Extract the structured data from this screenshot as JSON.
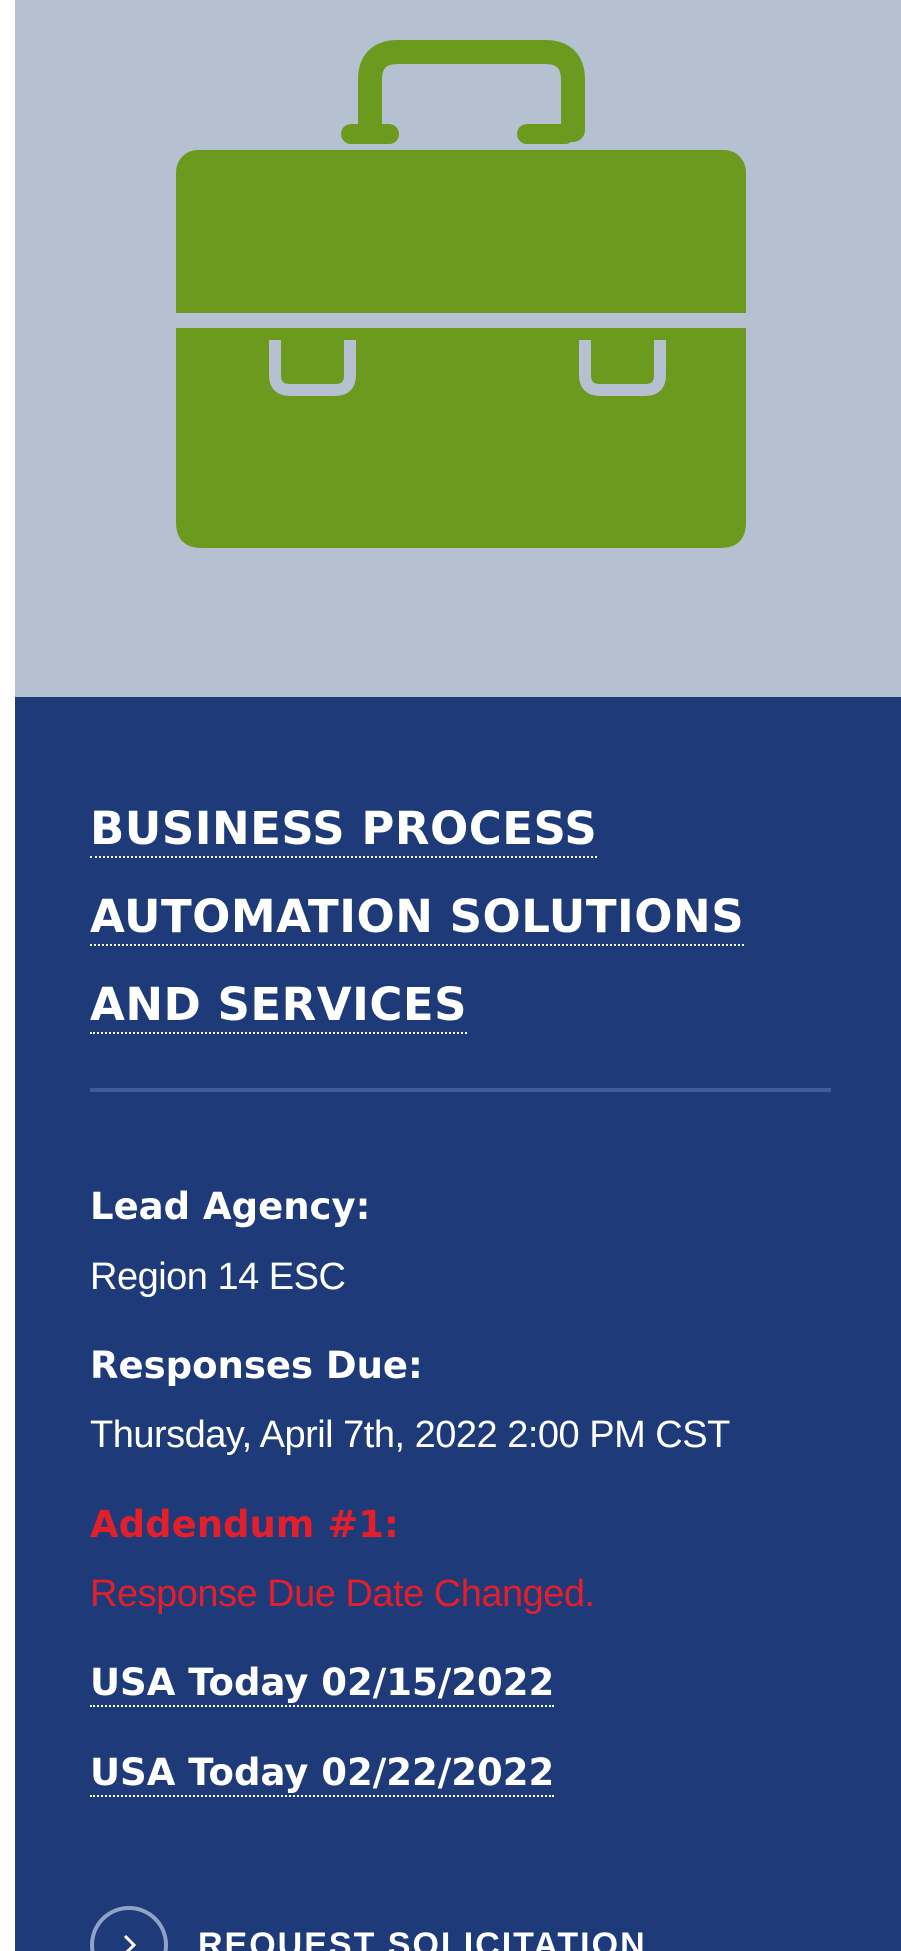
{
  "colors": {
    "hero_background": "#b5c0d0",
    "panel_background": "#1e3a78",
    "icon_green": "#6b9a1f",
    "alert_red": "#e21f2a"
  },
  "hero": {
    "icon": "briefcase-icon"
  },
  "solicitation": {
    "title_line1": "BUSINESS PROCESS",
    "title_line2": "AUTOMATION SOLUTIONS",
    "title_line3": "AND SERVICES",
    "lead_agency_label": "Lead Agency:",
    "lead_agency_value": "Region 14 ESC",
    "responses_due_label": "Responses Due:",
    "responses_due_value": "Thursday, April 7th, 2022 2:00 PM CST",
    "addendum_label": "Addendum #1:",
    "addendum_value": "Response Due Date Changed.",
    "links": [
      "USA Today 02/15/2022",
      "USA Today 02/22/2022"
    ],
    "request_button": {
      "icon": "chevron-right-icon",
      "label": "REQUEST SOLICITATION"
    }
  }
}
